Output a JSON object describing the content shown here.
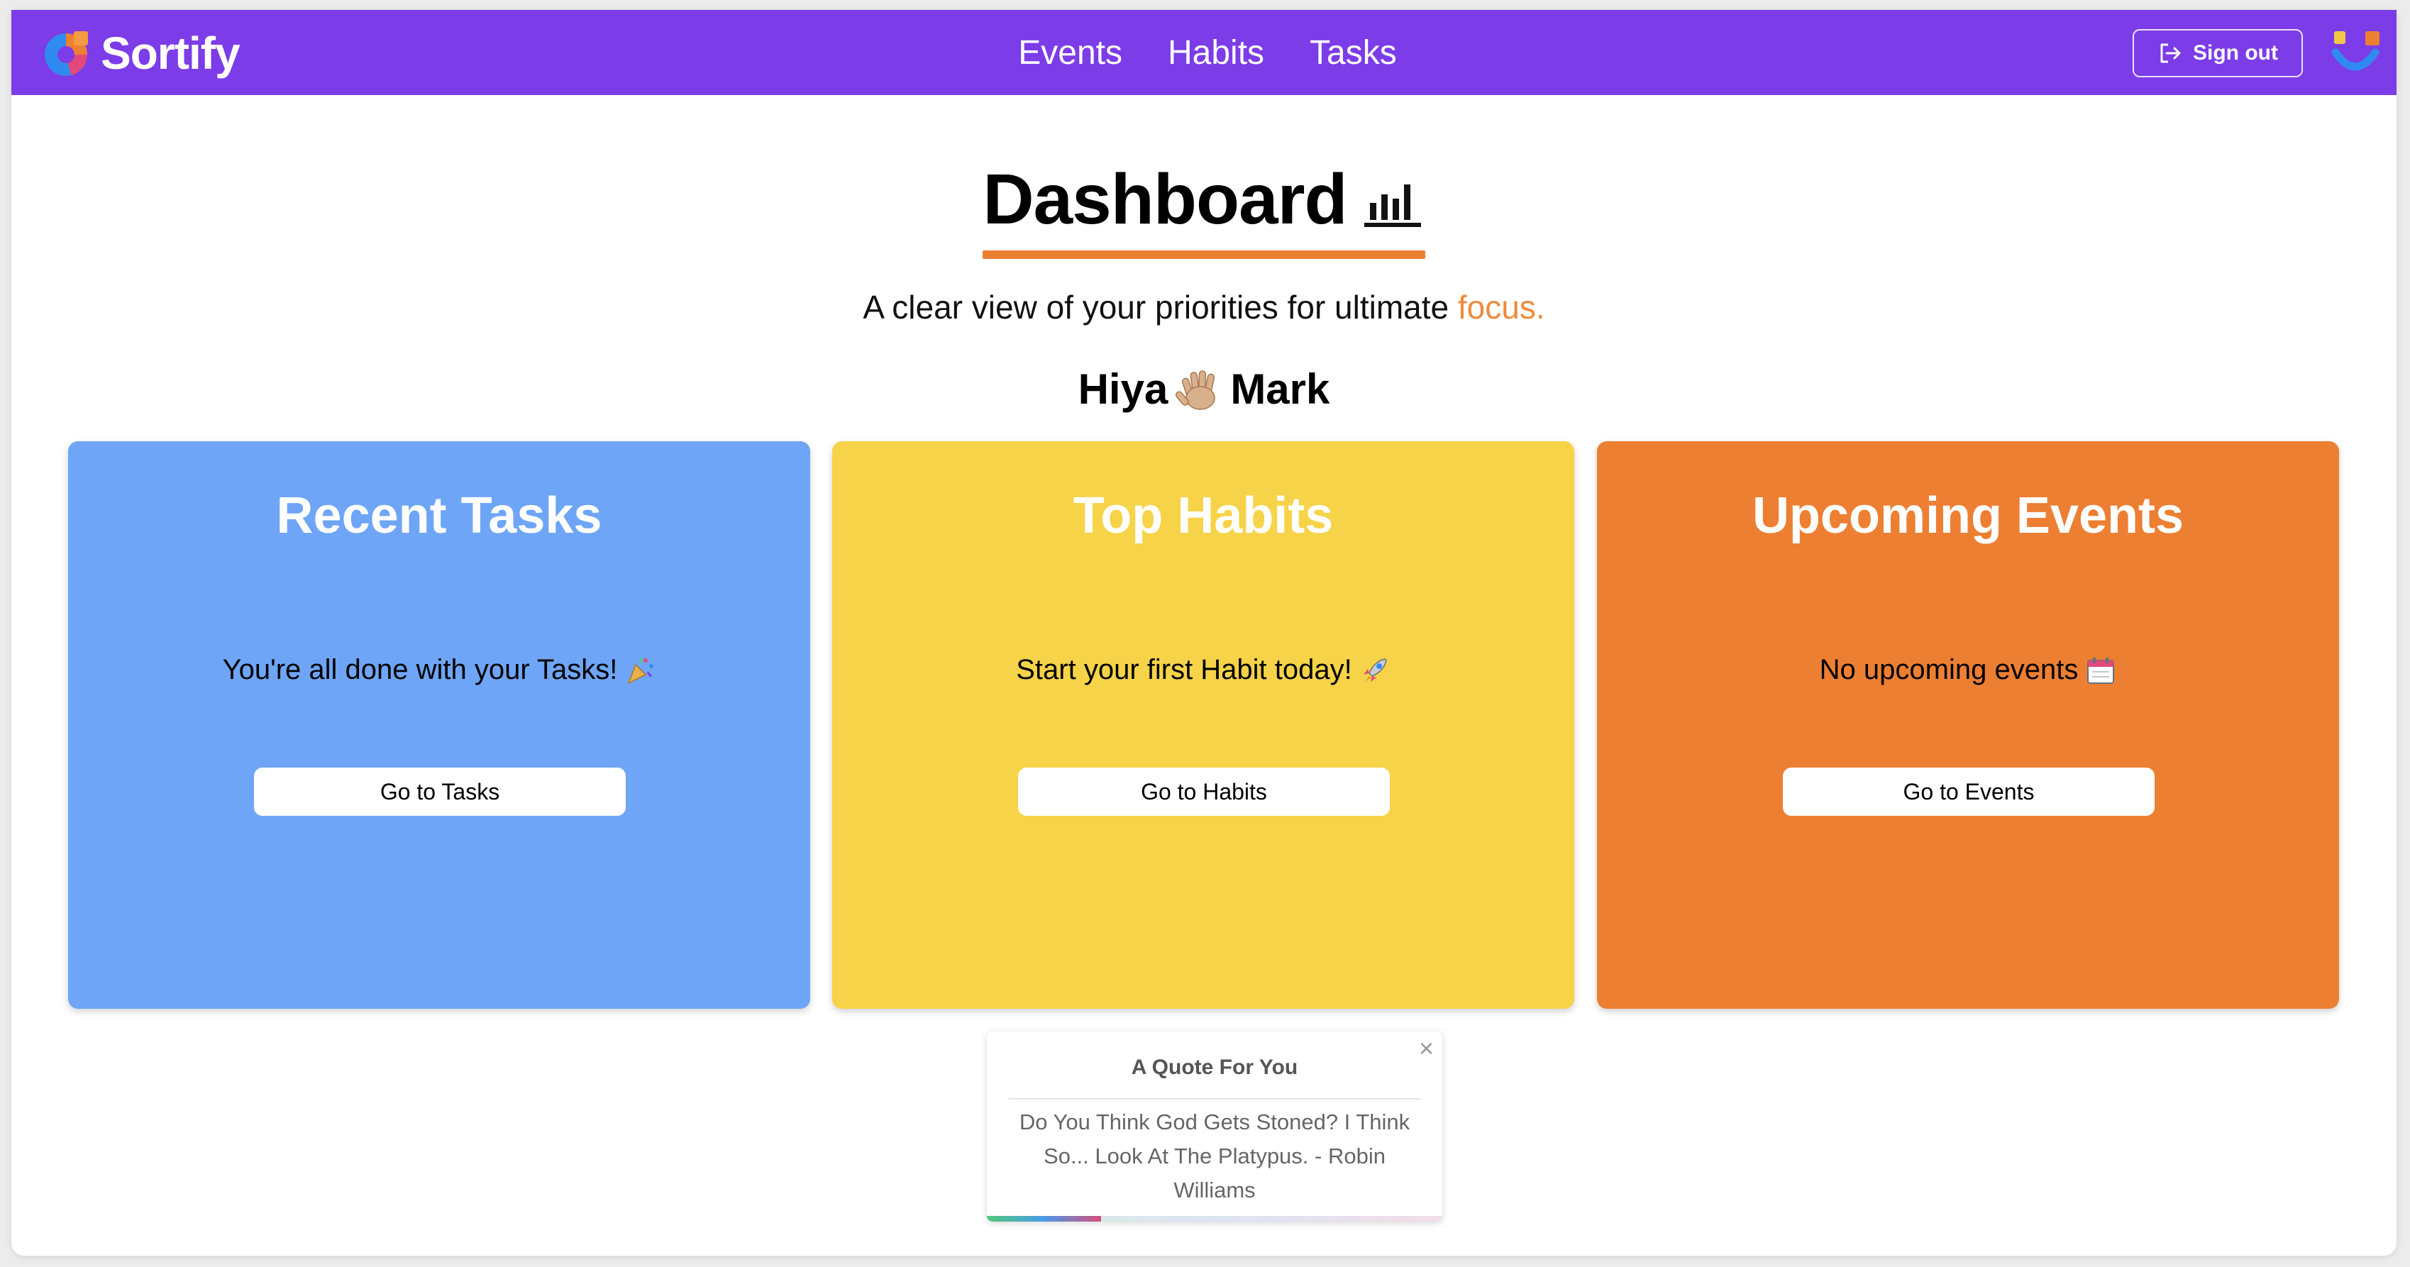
{
  "app": {
    "name": "Sortify",
    "colors": {
      "navbar": "#7c3ce8",
      "accent_orange": "#ed7f33",
      "tasks_card": "#6ea5f6",
      "habits_card": "#f6d348",
      "events_card": "#ed7f33"
    }
  },
  "nav": {
    "links": [
      {
        "label": "Events"
      },
      {
        "label": "Habits"
      },
      {
        "label": "Tasks"
      }
    ],
    "sign_out": {
      "label": "Sign out",
      "icon": "sign-out-icon"
    },
    "avatar_icon": "smile-avatar-icon"
  },
  "header": {
    "title": "Dashboard",
    "title_icon": "bar-chart-icon",
    "subtitle": "A clear view of your priorities for ultimate",
    "subtitle_accent": "focus.",
    "greeting_prefix": "Hiya",
    "greeting_icon": "waving-hand-icon",
    "greeting_name": "Mark"
  },
  "cards": [
    {
      "title": "Recent Tasks",
      "message": "You're all done with your Tasks!",
      "message_icon": "party-popper-icon",
      "button": "Go to Tasks"
    },
    {
      "title": "Top Habits",
      "message": "Start your first Habit today!",
      "message_icon": "rocket-icon",
      "button": "Go to Habits"
    },
    {
      "title": "Upcoming Events",
      "message": "No upcoming events",
      "message_icon": "calendar-icon",
      "button": "Go to Events"
    }
  ],
  "quote": {
    "title": "A Quote For You",
    "text": "Do You Think God Gets Stoned? I Think So... Look At The Platypus. - Robin Williams",
    "close_glyph": "×",
    "progress": 0.25
  }
}
